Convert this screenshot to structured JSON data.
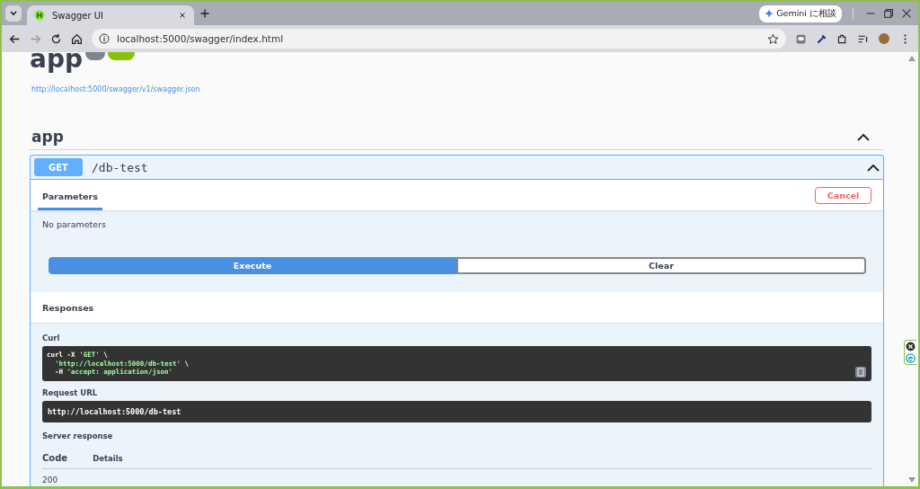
{
  "browser": {
    "tabs": [
      {
        "title": "Swagger UI",
        "selected": true
      }
    ],
    "gemini_button": "Gemini に相談",
    "address": "localhost:5000/swagger/index.html"
  },
  "page": {
    "title": "app",
    "spec_link": "http://localhost:5000/swagger/v1/swagger.json",
    "section": {
      "name": "app",
      "expanded": true,
      "operation": {
        "method": "GET",
        "path": "/db-test",
        "expanded": true,
        "tabs": [
          {
            "label": "Parameters",
            "selected": true
          }
        ],
        "cancel_button": "Cancel",
        "no_parameters": "No parameters",
        "execute_button": "Execute",
        "clear_button": "Clear",
        "responses_heading": "Responses",
        "curl_label": "Curl",
        "curl_lines": [
          "curl -X 'GET' \\",
          "  'http://localhost:5000/db-test' \\",
          "  -H 'accept: application/json'"
        ],
        "request_url_label": "Request URL",
        "request_url": "http://localhost:5000/db-test",
        "server_response_label": "Server response",
        "columns": [
          "Code",
          "Details"
        ],
        "rows": [
          {
            "code": "200"
          }
        ]
      }
    }
  }
}
